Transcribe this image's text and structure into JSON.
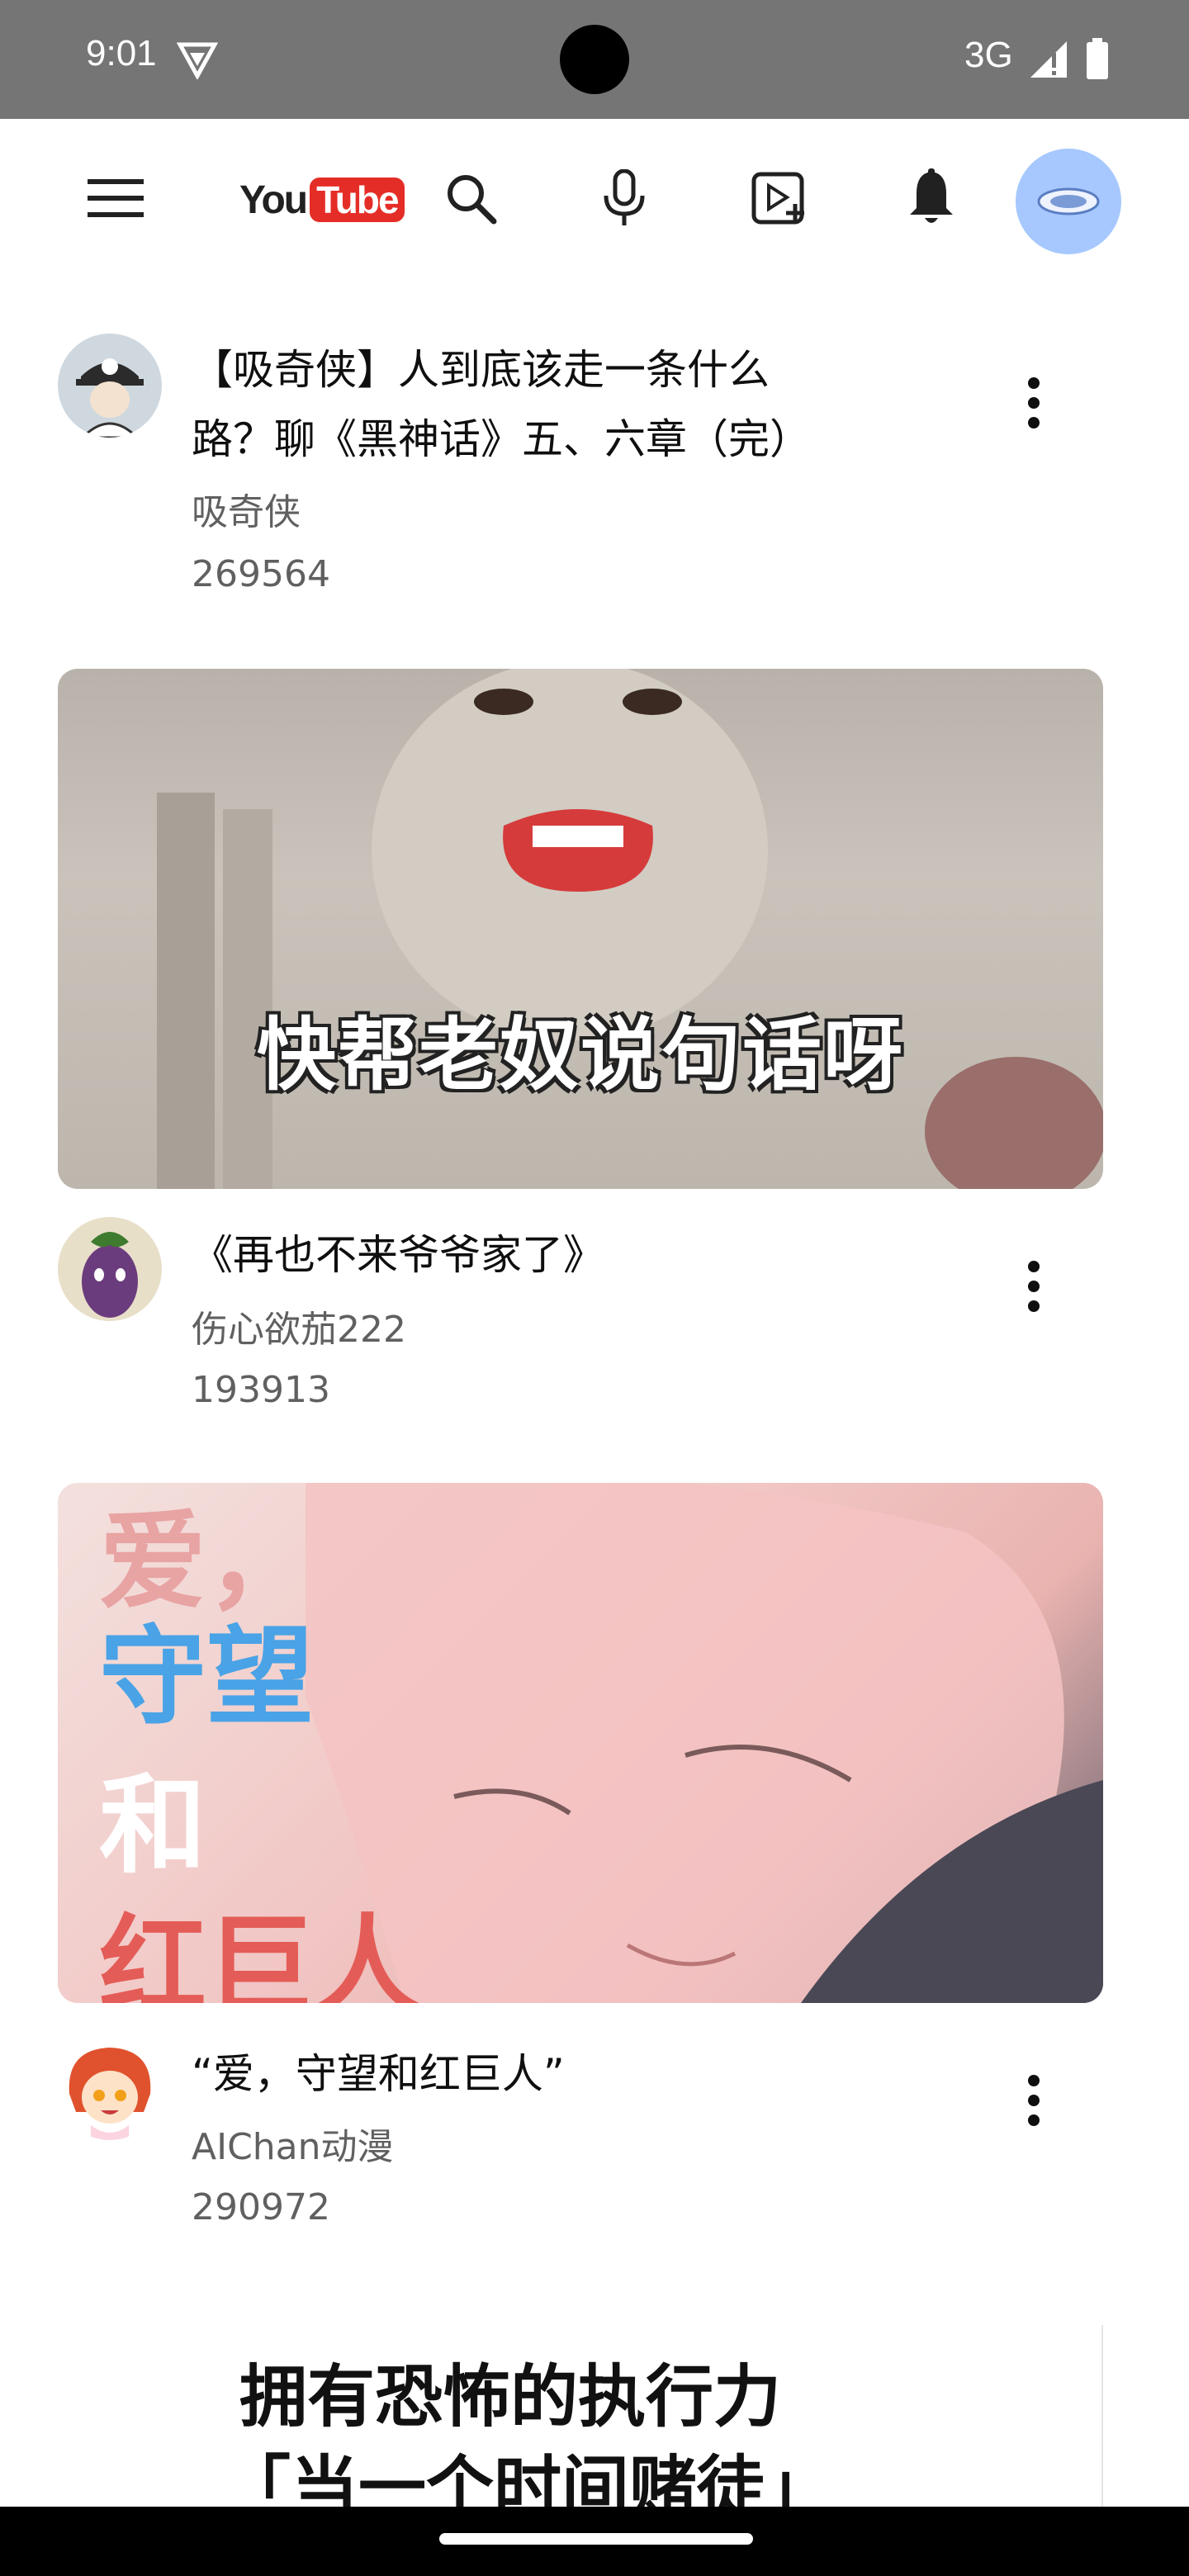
{
  "status_bar": {
    "time": "9:01",
    "network": "3G",
    "icons": [
      "vpn-icon",
      "signal-icon",
      "battery-icon"
    ]
  },
  "app_bar": {
    "logo_you": "You",
    "logo_tube": "Tube",
    "icons": [
      "menu-icon",
      "search-icon",
      "mic-icon",
      "create-icon",
      "notifications-icon",
      "account-avatar"
    ],
    "accent": "#ff0000"
  },
  "feed": [
    {
      "title_line1": "【吸奇侠】人到底该走一条什么",
      "title_line2": "路？聊《黑神话》五、六章（完）",
      "channel": "吸奇侠",
      "views": "269564"
    },
    {
      "thumbnail_caption": "快帮老奴说句话呀",
      "title": "《再也不来爷爷家了》",
      "channel": "伤心欲茄222",
      "views": "193913"
    },
    {
      "thumbnail_lines": [
        "爱，",
        "守望",
        "和",
        "红巨人"
      ],
      "title": "“爱，守望和红巨人”",
      "channel": "AIChan动漫",
      "views": "290972"
    },
    {
      "thumbnail_lines": [
        "拥有恐怖的执行力",
        "「当一个时间赌徒」"
      ]
    }
  ]
}
